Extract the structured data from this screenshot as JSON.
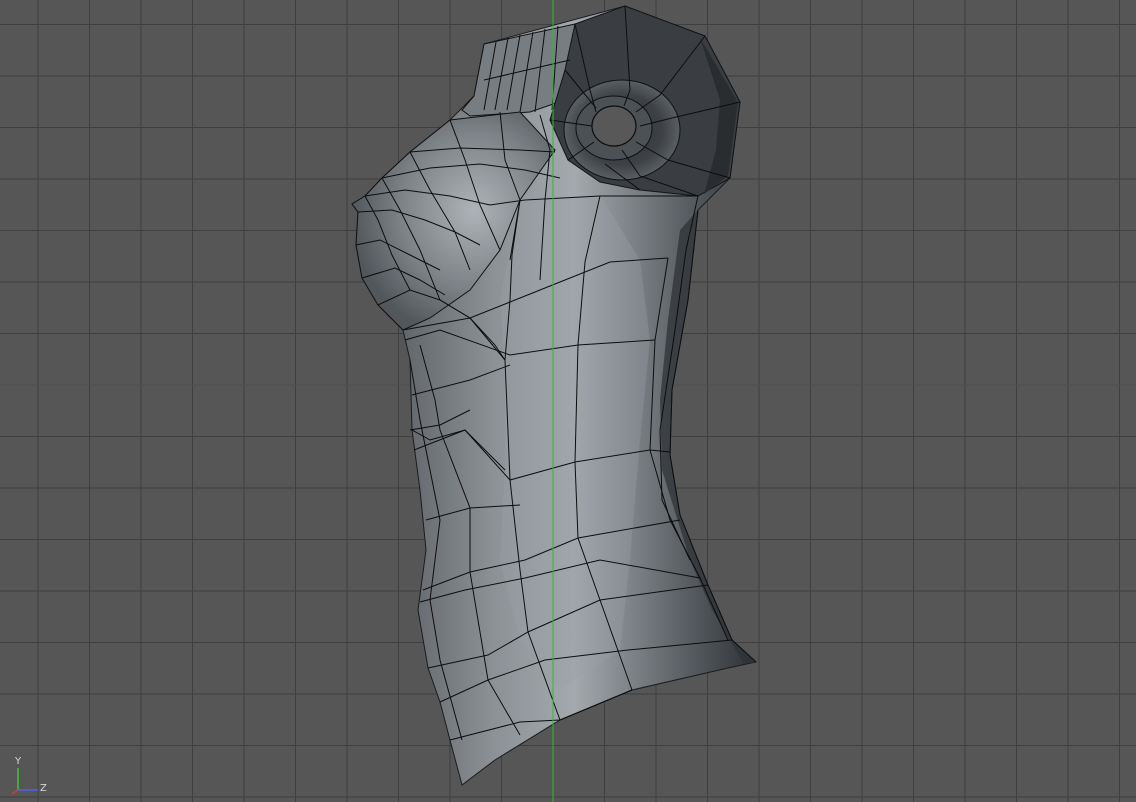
{
  "viewport": {
    "background": "#565656",
    "grid_color": "#3f3f3f",
    "vertical_axis_color": "#33b833",
    "horizontal_axis_color": "#4d4d4d",
    "object": {
      "name": "",
      "shading": "gouraud-with-wireframe",
      "base_color": "#6d7277",
      "highlight_color": "#a9aeb3",
      "shadow_color": "#2b2f33",
      "wire_color": "#0d0d0d"
    }
  },
  "axis_gizmo": {
    "y_label": "Y",
    "z_label": "Z",
    "y_color": "#3ec23e",
    "z_color": "#4a63e8"
  }
}
